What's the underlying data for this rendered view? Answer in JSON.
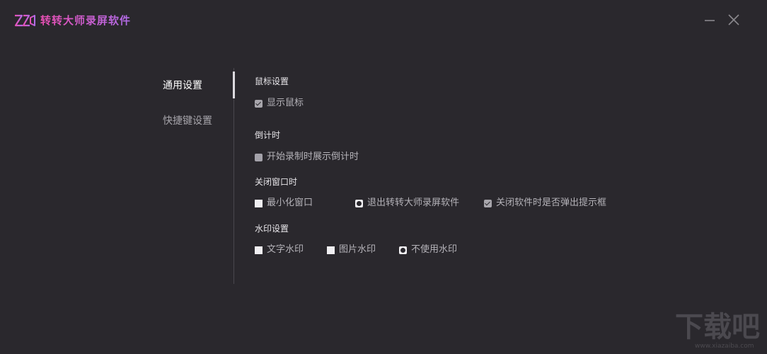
{
  "app": {
    "title": "转转大师录屏软件",
    "logo_icon": "zz-logo-icon",
    "accent_colors": [
      "#e94fb3",
      "#b06ce8"
    ]
  },
  "window_controls": {
    "minimize_icon": "minimize-icon",
    "close_icon": "close-icon"
  },
  "nav": {
    "items": [
      {
        "label": "通用设置",
        "active": true
      },
      {
        "label": "快捷键设置",
        "active": false
      }
    ]
  },
  "sections": {
    "mouse": {
      "title": "鼠标设置",
      "options": [
        {
          "label": "显示鼠标",
          "checked": true
        }
      ]
    },
    "countdown": {
      "title": "倒计时",
      "options": [
        {
          "label": "开始录制时展示倒计时",
          "checked": false
        }
      ]
    },
    "close_window": {
      "title": "关闭窗口时",
      "options": [
        {
          "label": "最小化窗口",
          "selected": false
        },
        {
          "label": "退出转转大师录屏软件",
          "selected": true
        },
        {
          "label": "关闭软件时是否弹出提示框",
          "checked": true
        }
      ]
    },
    "watermark": {
      "title": "水印设置",
      "options": [
        {
          "label": "文字水印",
          "selected": false
        },
        {
          "label": "图片水印",
          "selected": false
        },
        {
          "label": "不使用水印",
          "selected": true
        }
      ]
    }
  },
  "site_watermark": {
    "text": "下载吧",
    "url": "www.xiazaiba.com"
  }
}
